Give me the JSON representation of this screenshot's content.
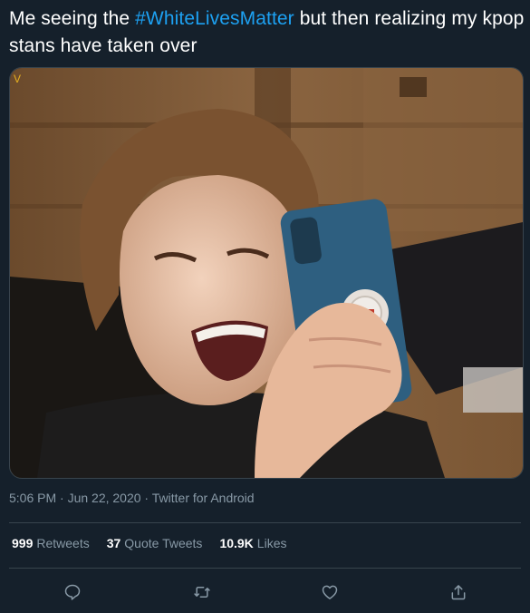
{
  "tweet": {
    "text_before": "Me seeing the ",
    "hashtag": "#WhiteLivesMatter",
    "text_after": " but then realizing my kpop stans have taken over"
  },
  "meta": {
    "timestamp": "5:06 PM · Jun 22, 2020",
    "separator": " · ",
    "source": "Twitter for Android"
  },
  "stats": {
    "retweets_count": "999",
    "retweets_label": "Retweets",
    "quotes_count": "37",
    "quotes_label": "Quote Tweets",
    "likes_count": "10.9K",
    "likes_label": "Likes"
  },
  "actions": [
    {
      "icon": "reply-icon"
    },
    {
      "icon": "retweet-icon"
    },
    {
      "icon": "like-icon"
    },
    {
      "icon": "share-icon"
    }
  ],
  "colors": {
    "background": "#15202b",
    "accent": "#1da1f2",
    "muted": "#8899a6",
    "border": "#38444d"
  }
}
